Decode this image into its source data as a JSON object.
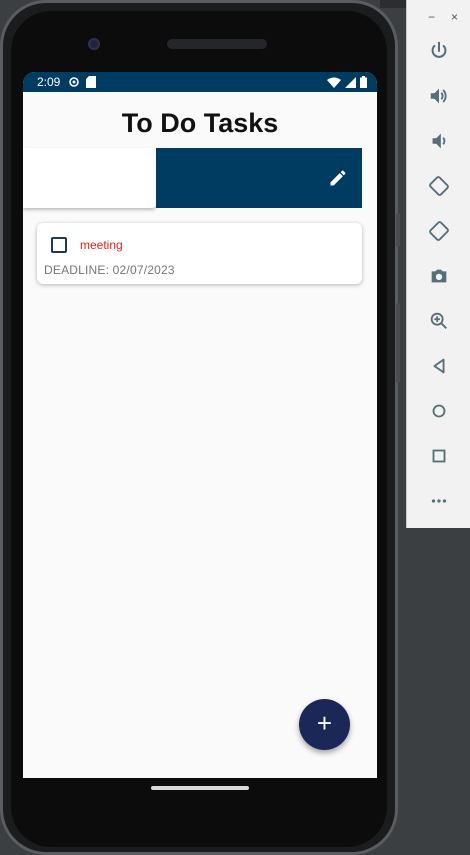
{
  "status_bar": {
    "time": "2:09"
  },
  "app": {
    "title": "To Do Tasks"
  },
  "tasks": [
    {
      "name": "meeting",
      "deadline": "DEADLINE: 02/07/2023",
      "checked": false
    }
  ],
  "fab": {
    "label": "+"
  },
  "emulator_toolbar": {
    "minimize": "−",
    "close": "×",
    "buttons": [
      "power-icon",
      "volume-up-icon",
      "volume-down-icon",
      "rotate-left-icon",
      "rotate-right-icon",
      "camera-icon",
      "zoom-icon",
      "back-icon",
      "home-icon",
      "overview-icon",
      "more-icon"
    ]
  },
  "colors": {
    "status_bar": "#003c62",
    "swipe_action": "#003c62",
    "task_name": "#e3221c",
    "fab": "#1b2757"
  }
}
